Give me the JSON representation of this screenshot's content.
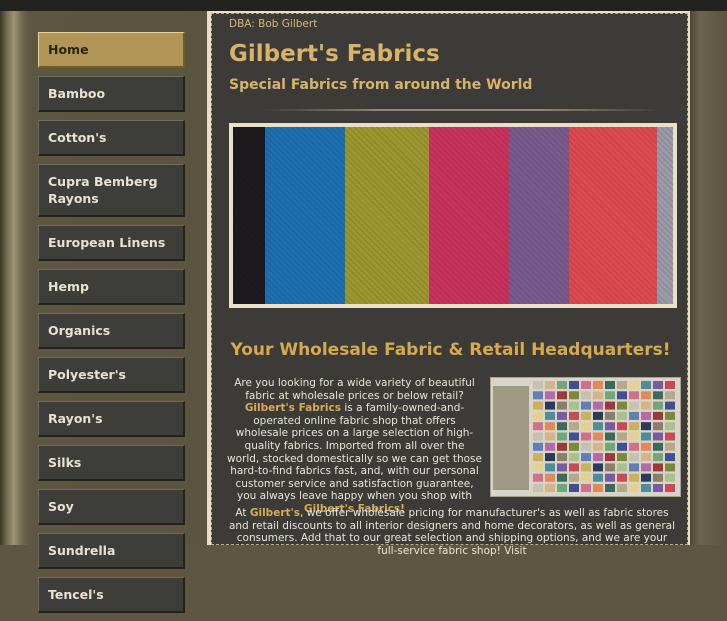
{
  "header": {
    "dba": "DBA: Bob Gilbert",
    "title": "Gilbert's Fabrics",
    "tagline": "Special Fabrics from around the World"
  },
  "sidebar": {
    "items": [
      {
        "label": "Home",
        "active": true
      },
      {
        "label": "Bamboo"
      },
      {
        "label": "Cotton's"
      },
      {
        "label": "Cupra Bemberg Rayons"
      },
      {
        "label": "European Linens"
      },
      {
        "label": "Hemp"
      },
      {
        "label": "Organics"
      },
      {
        "label": "Polyester's"
      },
      {
        "label": "Rayon's"
      },
      {
        "label": "Silks"
      },
      {
        "label": "Soy"
      },
      {
        "label": "Sundrella"
      },
      {
        "label": "Tencel's"
      }
    ]
  },
  "main": {
    "headline": "Your Wholesale Fabric & Retail Headquarters!",
    "p1": {
      "t1": "Are you looking for a wide variety of beautiful fabric at wholesale prices or below retail? ",
      "b1": "Gilbert's Fabrics",
      "t2": " is a family-owned-and-operated online fabric shop that offers wholesale prices on a large selection of high-quality fabrics. Imported from all over the world, stocked domestically so we can get those hard-to-find fabrics fast, and, with our personal customer service and satisfaction guarantee, you always leave happy when you shop with ",
      "b2": "Gilbert's Fabrics!"
    },
    "p2": {
      "t1": "At ",
      "b1": "Gilbert's",
      "t2": ", we offer wholesale pricing for manufacturer's as well as fabric stores and retail discounts to all interior designers and home decorators, as well as general consumers. Add that to our great selection and shipping options, and we are your full-service fabric shop! Visit"
    }
  },
  "colors": {
    "accent": "#d9b367",
    "fabric_stripes": [
      "#1c1a1d",
      "#1e6fb0",
      "#9c9530",
      "#c8335c",
      "#7a5a8e",
      "#dc4a50",
      "#9a9aa8"
    ]
  }
}
